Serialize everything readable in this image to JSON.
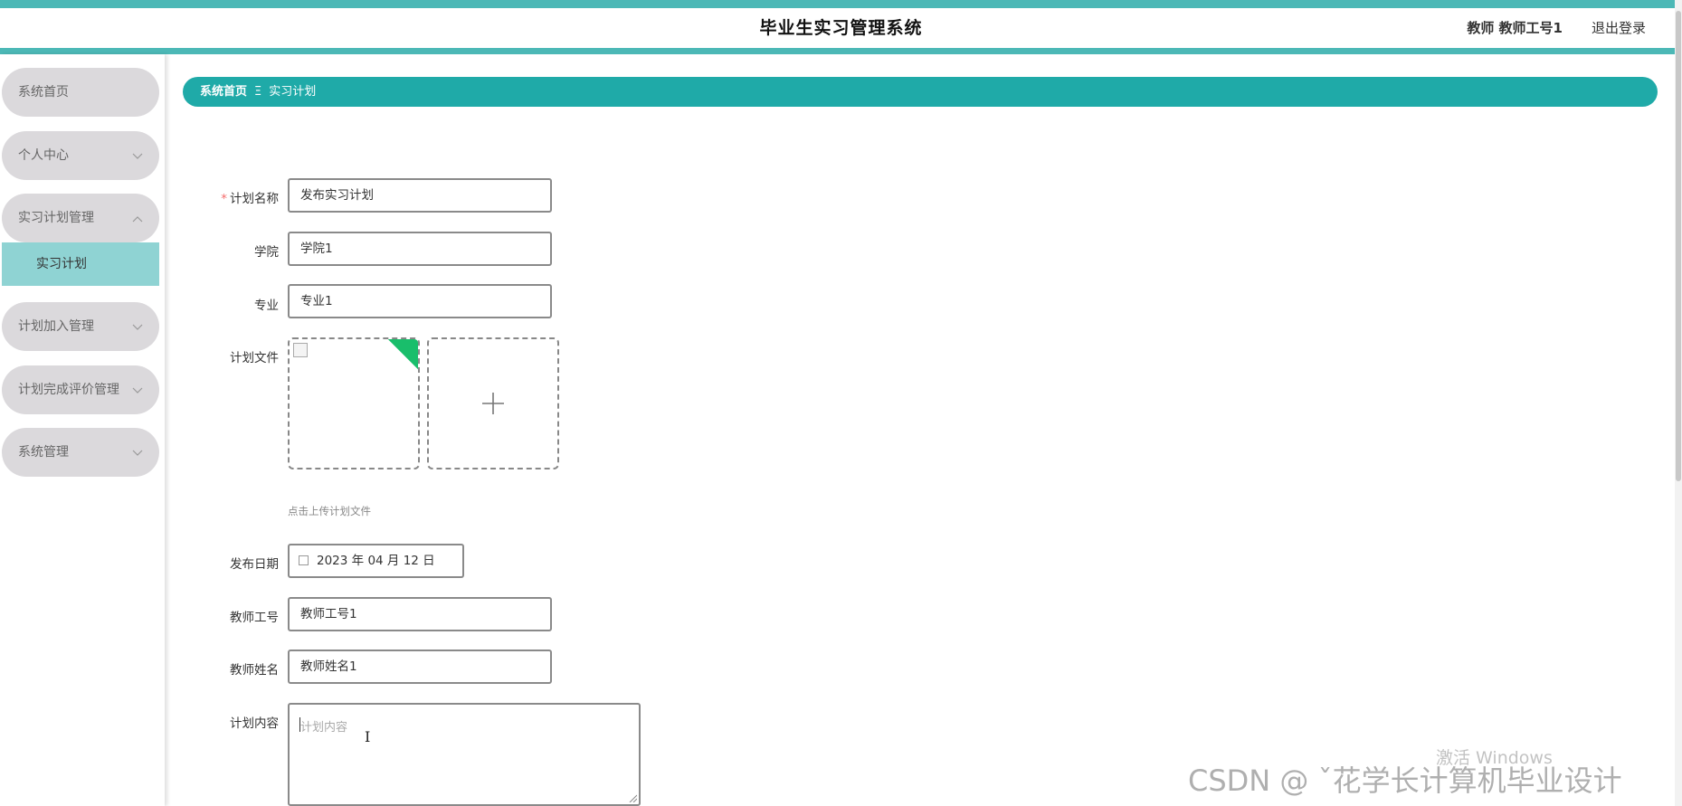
{
  "header": {
    "title": "毕业生实习管理系统",
    "user": "教师 教师工号1",
    "logout": "退出登录"
  },
  "sidebar": {
    "items": [
      {
        "label": "系统首页"
      },
      {
        "label": "个人中心",
        "icon": "chevron-down-icon"
      },
      {
        "label": "实习计划管理",
        "icon": "chevron-up-icon"
      },
      {
        "label": "计划加入管理",
        "icon": "chevron-down-icon"
      },
      {
        "label": "计划完成评价管理",
        "icon": "chevron-down-icon"
      },
      {
        "label": "系统管理",
        "icon": "chevron-down-icon"
      }
    ],
    "active_sub": "实习计划"
  },
  "breadcrumb": {
    "home": "系统首页",
    "separator": "Ξ",
    "current": "实习计划"
  },
  "form": {
    "plan_name": {
      "label": "计划名称",
      "value": "发布实习计划",
      "required_mark": "*"
    },
    "college": {
      "label": "学院",
      "value": "学院1"
    },
    "major": {
      "label": "专业",
      "value": "专业1"
    },
    "plan_file": {
      "label": "计划文件",
      "hint": "点击上传计划文件"
    },
    "publish_date": {
      "label": "发布日期",
      "value": "2023 年 04 月 12 日"
    },
    "teacher_id": {
      "label": "教师工号",
      "value": "教师工号1"
    },
    "teacher_name": {
      "label": "教师姓名",
      "value": "教师姓名1"
    },
    "plan_content": {
      "label": "计划内容",
      "placeholder": "计划内容"
    }
  },
  "overlay": {
    "windows": "激活 Windows",
    "csdn": "CSDN @ ˇ花学长计算机毕业设计"
  },
  "colors": {
    "accent": "#1faaa8",
    "header_line": "#4cb8b6",
    "active_sub": "#8fd3d3",
    "menu_bg": "#dbd9dc",
    "upload_done": "#19be6b"
  }
}
